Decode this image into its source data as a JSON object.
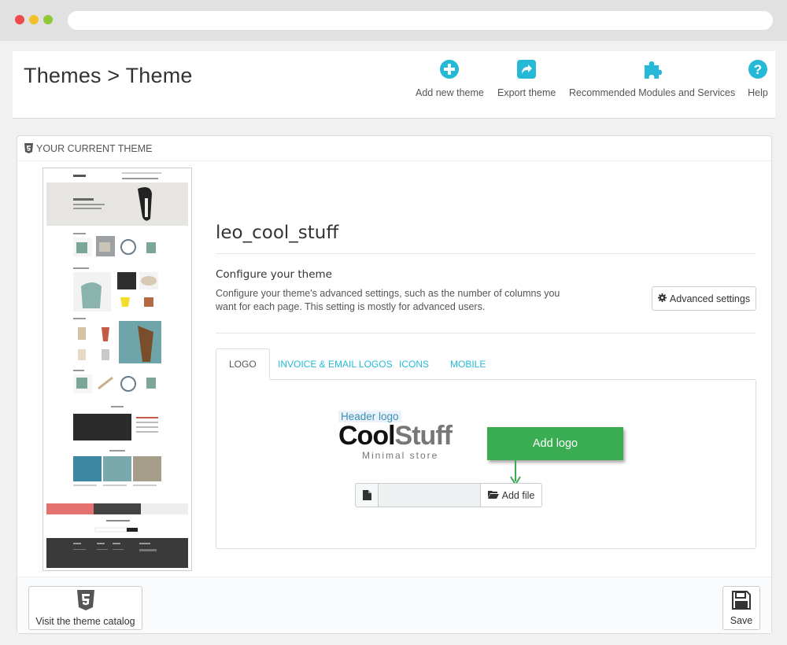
{
  "header": {
    "title": "Themes > Theme",
    "toolbar": [
      {
        "label": "Add new theme",
        "icon": "plus-circle-icon"
      },
      {
        "label": "Export theme",
        "icon": "export-icon"
      },
      {
        "label": "Recommended Modules and Services",
        "icon": "puzzle-icon"
      },
      {
        "label": "Help",
        "icon": "help-icon"
      }
    ]
  },
  "panel": {
    "heading": "Your current theme",
    "heading_icon": "html5-icon",
    "theme_name": "leo_cool_stuff",
    "configure_title": "Configure your theme",
    "configure_description": "Configure your theme's advanced settings, such as the number of columns you want for each page. This setting is mostly for advanced users.",
    "advanced_button": "Advanced settings",
    "tabs": [
      "Logo",
      "Invoice & Email Logos",
      "Icons",
      "Mobile"
    ],
    "active_tab": "Logo",
    "logo_tab": {
      "label": "Header logo",
      "logo_word_1": "Cool",
      "logo_word_2": "Stuff",
      "logo_tagline": "Minimal store",
      "callout": "Add logo",
      "add_file": "Add file"
    },
    "footer": {
      "catalog_button": "Visit the theme catalog",
      "save_button": "Save"
    }
  },
  "colors": {
    "accent": "#25b9d7",
    "callout_green": "#3aad52"
  }
}
